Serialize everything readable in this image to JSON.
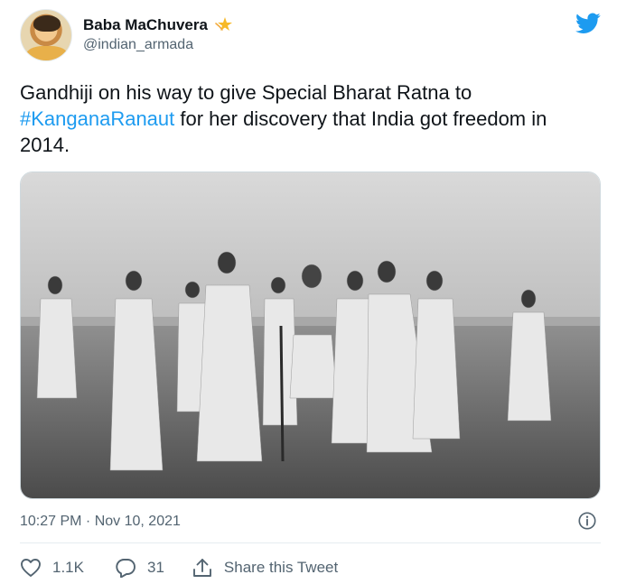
{
  "user": {
    "display_name": "Baba MaChuvera",
    "handle": "@indian_armada",
    "badge_emoji": "sparkle-star"
  },
  "tweet": {
    "text_before": "Gandhiji on his way to give Special Bharat Ratna to ",
    "hashtag": "#KanganaRanaut",
    "text_after": " for her discovery that India got freedom in 2014.",
    "timestamp": "10:27 PM · Nov 10, 2021"
  },
  "actions": {
    "like_count": "1.1K",
    "reply_count": "31",
    "share_label": "Share this Tweet"
  },
  "colors": {
    "accent": "#1d9bf0",
    "muted": "#536471",
    "text": "#0f1419"
  }
}
